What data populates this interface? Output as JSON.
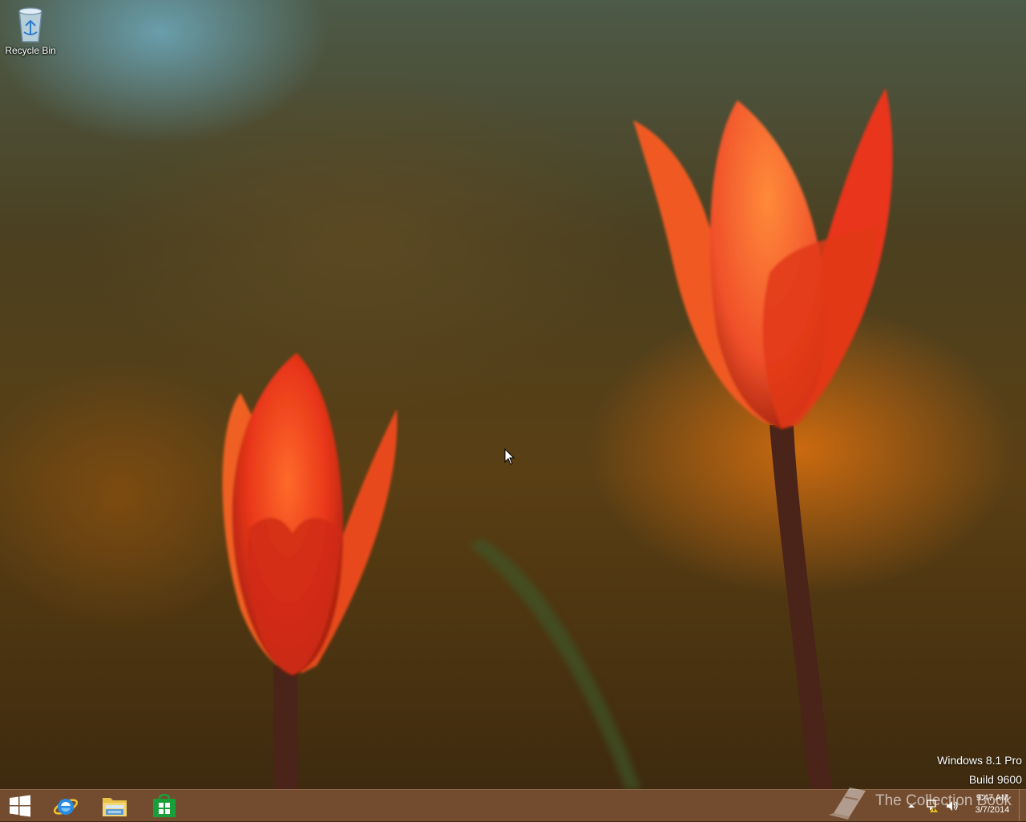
{
  "desktop": {
    "icons": [
      {
        "label": "Recycle Bin",
        "icon": "recycle-bin-icon"
      }
    ],
    "watermark": {
      "edition": "Windows 8.1 Pro",
      "build": "Build 9600"
    },
    "overlay_logo_text": "The Collection Book"
  },
  "taskbar": {
    "pinned": [
      {
        "name": "start",
        "icon": "windows-logo-icon"
      },
      {
        "name": "internet-explorer",
        "icon": "ie-icon"
      },
      {
        "name": "file-explorer",
        "icon": "folder-icon"
      },
      {
        "name": "store",
        "icon": "store-bag-icon"
      }
    ],
    "tray": {
      "icons": [
        "chevron-up-icon",
        "network-icon",
        "volume-icon"
      ],
      "time": "9:47 AM",
      "date": "3/7/2014"
    }
  },
  "colors": {
    "taskbar": "#764e32",
    "ie_blue": "#1e7fd4",
    "store_green": "#1a9e3a",
    "tulip_red": "#e8361a"
  }
}
